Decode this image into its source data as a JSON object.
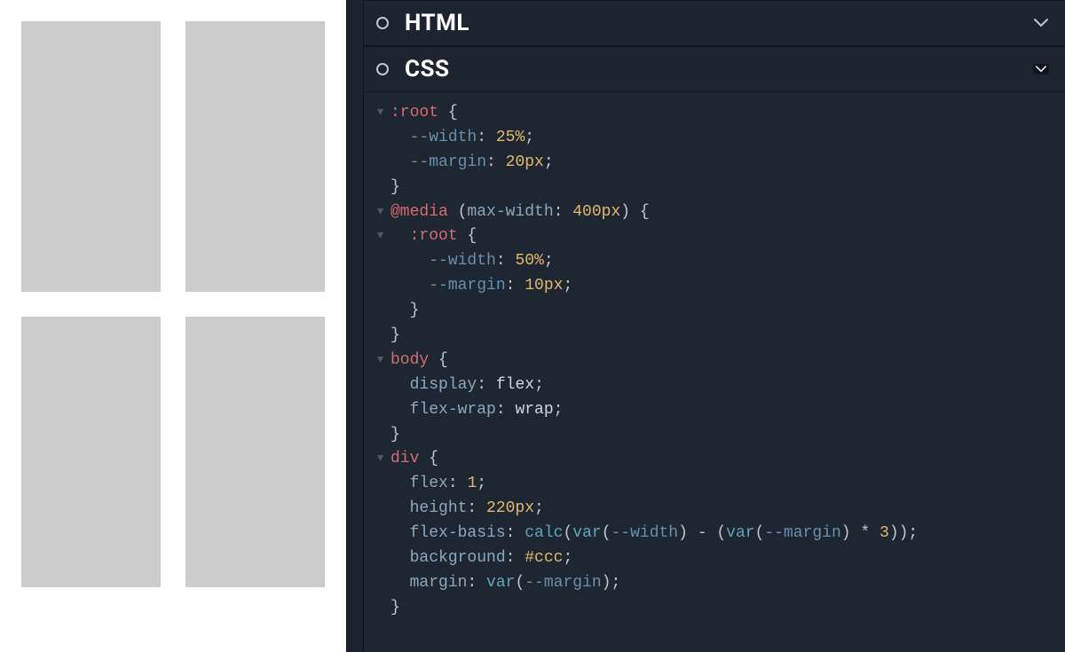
{
  "panels": {
    "html": {
      "title": "HTML",
      "expanded": false
    },
    "css": {
      "title": "CSS",
      "expanded": true
    }
  },
  "css_code": {
    "lines": [
      {
        "fold": true,
        "indent": 0,
        "tokens": [
          {
            "t": ":root",
            "c": "tk-sel"
          },
          {
            "t": " {",
            "c": "tk-punc"
          }
        ]
      },
      {
        "fold": false,
        "indent": 1,
        "tokens": [
          {
            "t": "--width",
            "c": "tk-var"
          },
          {
            "t": ": ",
            "c": "tk-punc"
          },
          {
            "t": "25%",
            "c": "tk-num"
          },
          {
            "t": ";",
            "c": "tk-punc"
          }
        ]
      },
      {
        "fold": false,
        "indent": 1,
        "tokens": [
          {
            "t": "--margin",
            "c": "tk-var"
          },
          {
            "t": ": ",
            "c": "tk-punc"
          },
          {
            "t": "20px",
            "c": "tk-num"
          },
          {
            "t": ";",
            "c": "tk-punc"
          }
        ]
      },
      {
        "fold": false,
        "indent": 0,
        "tokens": [
          {
            "t": "}",
            "c": "tk-punc"
          }
        ]
      },
      {
        "fold": true,
        "indent": 0,
        "tokens": [
          {
            "t": "@media",
            "c": "tk-sel"
          },
          {
            "t": " (",
            "c": "tk-punc"
          },
          {
            "t": "max-width",
            "c": "tk-prop"
          },
          {
            "t": ": ",
            "c": "tk-punc"
          },
          {
            "t": "400px",
            "c": "tk-num"
          },
          {
            "t": ") {",
            "c": "tk-punc"
          }
        ]
      },
      {
        "fold": true,
        "indent": 1,
        "tokens": [
          {
            "t": ":root",
            "c": "tk-sel"
          },
          {
            "t": " {",
            "c": "tk-punc"
          }
        ]
      },
      {
        "fold": false,
        "indent": 2,
        "tokens": [
          {
            "t": "--width",
            "c": "tk-var"
          },
          {
            "t": ": ",
            "c": "tk-punc"
          },
          {
            "t": "50%",
            "c": "tk-num"
          },
          {
            "t": ";",
            "c": "tk-punc"
          }
        ]
      },
      {
        "fold": false,
        "indent": 2,
        "tokens": [
          {
            "t": "--margin",
            "c": "tk-var"
          },
          {
            "t": ": ",
            "c": "tk-punc"
          },
          {
            "t": "10px",
            "c": "tk-num"
          },
          {
            "t": ";",
            "c": "tk-punc"
          }
        ]
      },
      {
        "fold": false,
        "indent": 1,
        "tokens": [
          {
            "t": "}",
            "c": "tk-punc"
          }
        ]
      },
      {
        "fold": false,
        "indent": 0,
        "tokens": [
          {
            "t": "}",
            "c": "tk-punc"
          }
        ]
      },
      {
        "fold": true,
        "indent": 0,
        "tokens": [
          {
            "t": "body",
            "c": "tk-sel"
          },
          {
            "t": " {",
            "c": "tk-punc"
          }
        ]
      },
      {
        "fold": false,
        "indent": 1,
        "tokens": [
          {
            "t": "display",
            "c": "tk-prop"
          },
          {
            "t": ": ",
            "c": "tk-punc"
          },
          {
            "t": "flex",
            "c": "tk-kw"
          },
          {
            "t": ";",
            "c": "tk-punc"
          }
        ]
      },
      {
        "fold": false,
        "indent": 1,
        "tokens": [
          {
            "t": "flex-wrap",
            "c": "tk-prop"
          },
          {
            "t": ": ",
            "c": "tk-punc"
          },
          {
            "t": "wrap",
            "c": "tk-kw"
          },
          {
            "t": ";",
            "c": "tk-punc"
          }
        ]
      },
      {
        "fold": false,
        "indent": 0,
        "tokens": [
          {
            "t": "}",
            "c": "tk-punc"
          }
        ]
      },
      {
        "fold": true,
        "indent": 0,
        "tokens": [
          {
            "t": "div",
            "c": "tk-sel"
          },
          {
            "t": " {",
            "c": "tk-punc"
          }
        ]
      },
      {
        "fold": false,
        "indent": 1,
        "tokens": [
          {
            "t": "flex",
            "c": "tk-prop"
          },
          {
            "t": ": ",
            "c": "tk-punc"
          },
          {
            "t": "1",
            "c": "tk-num"
          },
          {
            "t": ";",
            "c": "tk-punc"
          }
        ]
      },
      {
        "fold": false,
        "indent": 1,
        "tokens": [
          {
            "t": "height",
            "c": "tk-prop"
          },
          {
            "t": ": ",
            "c": "tk-punc"
          },
          {
            "t": "220px",
            "c": "tk-num"
          },
          {
            "t": ";",
            "c": "tk-punc"
          }
        ]
      },
      {
        "fold": false,
        "indent": 1,
        "tokens": [
          {
            "t": "flex-basis",
            "c": "tk-prop"
          },
          {
            "t": ": ",
            "c": "tk-punc"
          },
          {
            "t": "calc",
            "c": "tk-fn"
          },
          {
            "t": "(",
            "c": "tk-punc"
          },
          {
            "t": "var",
            "c": "tk-fn"
          },
          {
            "t": "(",
            "c": "tk-punc"
          },
          {
            "t": "--width",
            "c": "tk-var"
          },
          {
            "t": ") - (",
            "c": "tk-punc"
          },
          {
            "t": "var",
            "c": "tk-fn"
          },
          {
            "t": "(",
            "c": "tk-punc"
          },
          {
            "t": "--margin",
            "c": "tk-var"
          },
          {
            "t": ") * ",
            "c": "tk-punc"
          },
          {
            "t": "3",
            "c": "tk-num"
          },
          {
            "t": "));",
            "c": "tk-punc"
          }
        ]
      },
      {
        "fold": false,
        "indent": 1,
        "tokens": [
          {
            "t": "background",
            "c": "tk-prop"
          },
          {
            "t": ": ",
            "c": "tk-punc"
          },
          {
            "t": "#ccc",
            "c": "tk-num"
          },
          {
            "t": ";",
            "c": "tk-punc"
          }
        ]
      },
      {
        "fold": false,
        "indent": 1,
        "tokens": [
          {
            "t": "margin",
            "c": "tk-prop"
          },
          {
            "t": ": ",
            "c": "tk-punc"
          },
          {
            "t": "var",
            "c": "tk-fn"
          },
          {
            "t": "(",
            "c": "tk-punc"
          },
          {
            "t": "--margin",
            "c": "tk-var"
          },
          {
            "t": ");",
            "c": "tk-punc"
          }
        ]
      },
      {
        "fold": false,
        "indent": 0,
        "tokens": [
          {
            "t": "}",
            "c": "tk-punc"
          }
        ]
      }
    ]
  }
}
